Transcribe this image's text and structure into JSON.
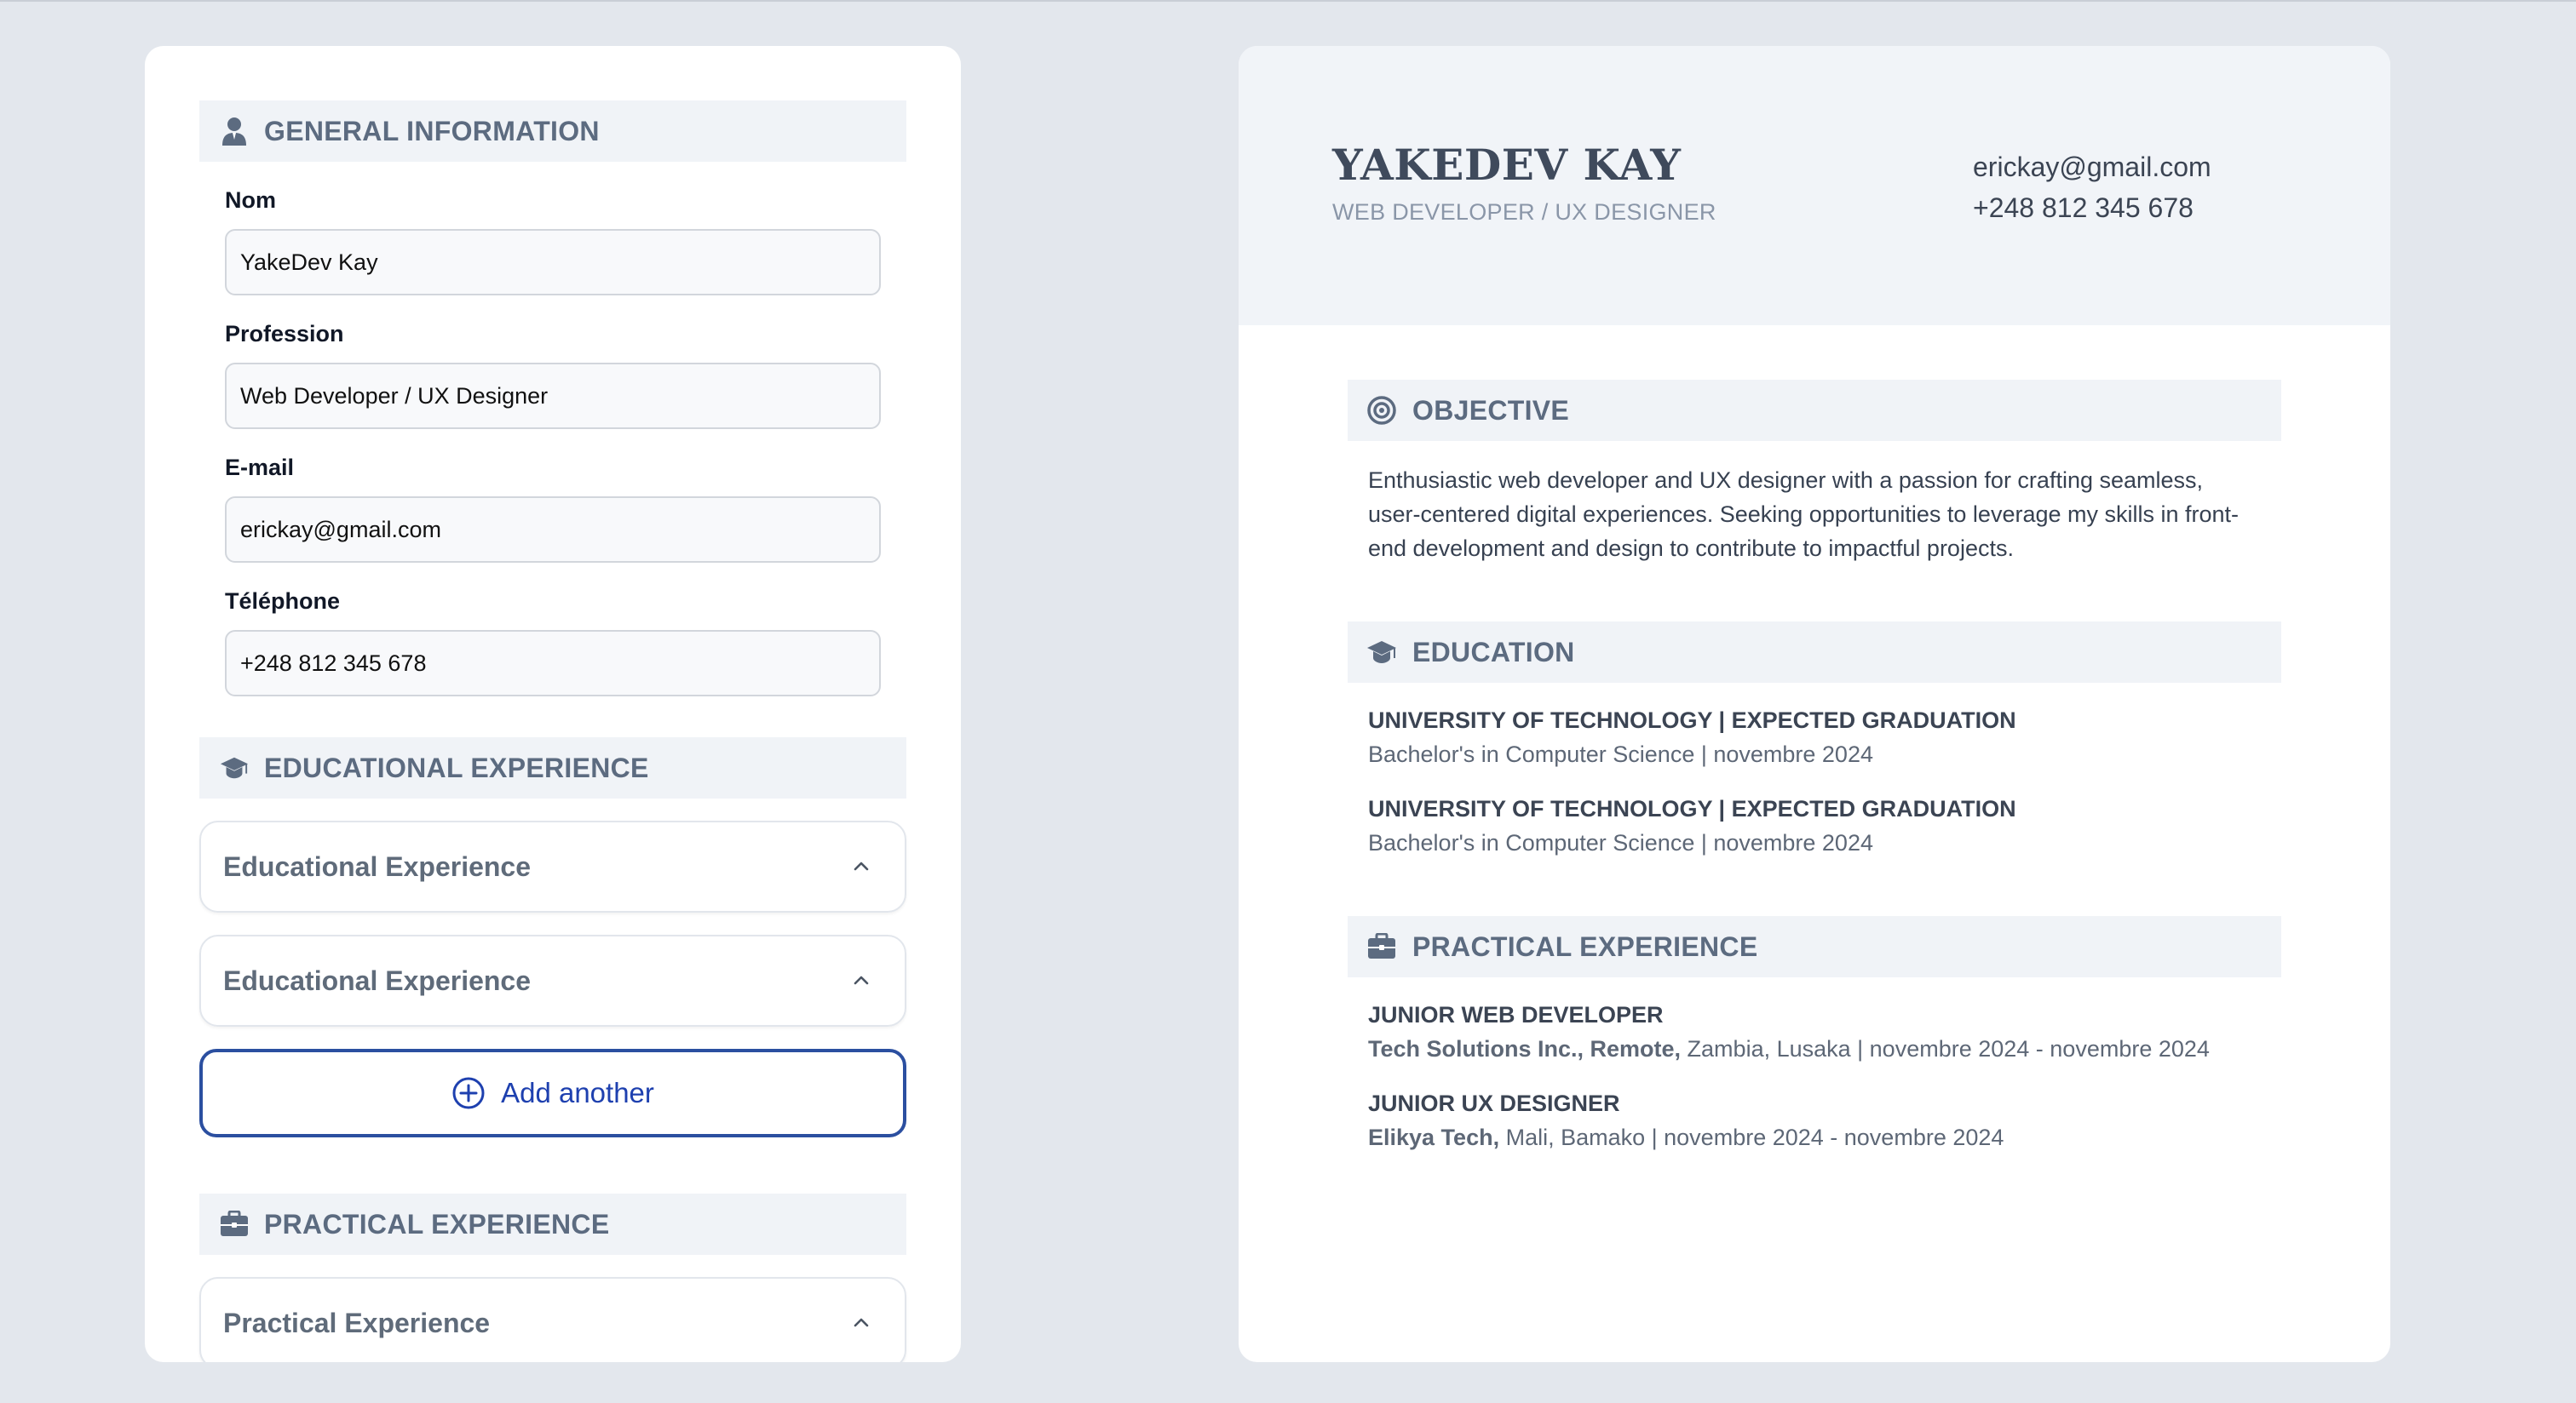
{
  "form": {
    "general": {
      "title": "GENERAL INFORMATION",
      "fields": [
        {
          "label": "Nom",
          "value": "YakeDev Kay"
        },
        {
          "label": "Profession",
          "value": "Web Developer / UX Designer"
        },
        {
          "label": "E-mail",
          "value": "erickay@gmail.com"
        },
        {
          "label": "Téléphone",
          "value": "+248 812 345 678"
        }
      ]
    },
    "educational": {
      "title": "EDUCATIONAL EXPERIENCE",
      "items": [
        "Educational Experience",
        "Educational Experience"
      ],
      "add_label": "Add another"
    },
    "practical": {
      "title": "PRACTICAL EXPERIENCE",
      "items": [
        "Practical Experience"
      ]
    }
  },
  "resume": {
    "name": "YAKEDEV KAY",
    "profession": "WEB DEVELOPER / UX DESIGNER",
    "email": "erickay@gmail.com",
    "phone": "+248 812 345 678",
    "objective": {
      "title": "OBJECTIVE",
      "text": "Enthusiastic web developer and UX designer with a passion for crafting seamless, user-centered digital experiences. Seeking opportunities to leverage my skills in front-end development and design to contribute to impactful projects."
    },
    "education": {
      "title": "EDUCATION",
      "entries": [
        {
          "title": "UNIVERSITY OF TECHNOLOGY | EXPECTED GRADUATION",
          "sub": "Bachelor's in Computer Science | novembre 2024"
        },
        {
          "title": "UNIVERSITY OF TECHNOLOGY | EXPECTED GRADUATION",
          "sub": "Bachelor's in Computer Science | novembre 2024"
        }
      ]
    },
    "practical": {
      "title": "PRACTICAL EXPERIENCE",
      "entries": [
        {
          "title": "JUNIOR WEB DEVELOPER",
          "company": "Tech Solutions Inc., Remote,",
          "rest": " Zambia, Lusaka | novembre 2024 - novembre 2024"
        },
        {
          "title": "JUNIOR UX DESIGNER",
          "company": "Elikya Tech,",
          "rest": " Mali, Bamako | novembre 2024 - novembre 2024"
        }
      ]
    }
  },
  "colors": {
    "page_bg": "#e3e7ed",
    "section_header_bg": "#f0f3f7",
    "section_title": "#5c6b80",
    "accent_blue": "#1e40af"
  },
  "icons": {
    "general": "user-icon",
    "educational": "graduation-cap-icon",
    "practical": "briefcase-icon",
    "objective": "target-icon",
    "accordion": "chevron-up-icon",
    "add": "plus-circle-icon"
  }
}
